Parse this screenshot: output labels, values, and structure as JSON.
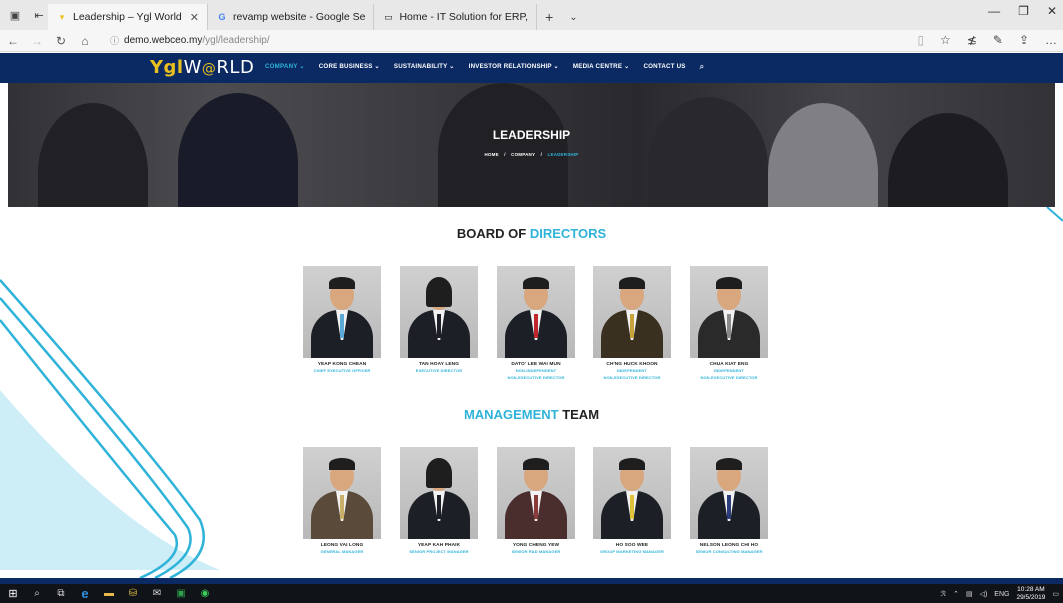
{
  "browser": {
    "tabs": [
      {
        "label": "Leadership – Ygl World",
        "icon": "ygl-favicon-icon",
        "active": true
      },
      {
        "label": "revamp website - Google Se",
        "icon": "google-icon",
        "active": false
      },
      {
        "label": "Home - IT Solution for ERP,",
        "icon": "page-icon",
        "active": false
      }
    ],
    "new_tab": "+",
    "url_host": "demo.webceo.my",
    "url_path": "/ygl/leadership/"
  },
  "site": {
    "logo_main": "Ygl",
    "logo_second": "W",
    "logo_o": "@",
    "logo_rest": "RLD",
    "menu": [
      {
        "label": "COMPANY ⌄",
        "active": true
      },
      {
        "label": "CORE BUSINESS ⌄",
        "active": false
      },
      {
        "label": "SUSTAINABILITY ⌄",
        "active": false
      },
      {
        "label": "INVESTOR RELATIONSHIP ⌄",
        "active": false
      },
      {
        "label": "MEDIA CENTRE ⌄",
        "active": false
      },
      {
        "label": "CONTACT US",
        "active": false
      }
    ],
    "search_glyph": "⌕"
  },
  "hero": {
    "title": "LEADERSHIP",
    "crumb_home": "HOME",
    "crumb_sep": "/",
    "crumb_company": "COMPANY",
    "crumb_current": "LEADERSHIP"
  },
  "board": {
    "title_a": "BOARD OF ",
    "title_b": "DIRECTORS",
    "people": [
      {
        "name": "YEAP KONG CHEAN",
        "role": "CHIEF EXECUTIVE OFFICER",
        "role2": "",
        "tie": "#5aa9d6"
      },
      {
        "name": "TAN HOAY LENG",
        "role": "EXECUTIVE DIRECTOR",
        "role2": "",
        "tie": "#1c1f26"
      },
      {
        "name": "DATO' LEE WAI MUN",
        "role": "NON-INDEPENDENT",
        "role2": "NON-EXECUTIVE DIRECTOR",
        "tie": "#c0272d"
      },
      {
        "name": "CH'NG HUCK KHOON",
        "role": "INDEPENDENT",
        "role2": "NON-EXECUTIVE DIRECTOR",
        "tie": "#c9a23c"
      },
      {
        "name": "CHUA KIAT ENG",
        "role": "INDEPENDENT",
        "role2": "NON-EXECUTIVE DIRECTOR",
        "tie": "#8a8a8a"
      }
    ]
  },
  "management": {
    "title_a": "MANAGEMENT",
    "title_b": " TEAM",
    "people": [
      {
        "name": "LEONG VAI LONG",
        "role": "GENERAL MANAGER",
        "tie": "#c8b06a"
      },
      {
        "name": "YEAP KAH PHAIK",
        "role": "SENIOR PROJECT MANAGER",
        "tie": "#1c1f26"
      },
      {
        "name": "YONG CHENG YEW",
        "role": "SENIOR R&D MANAGER",
        "tie": "#8b3a3a"
      },
      {
        "name": "HO SOO WEE",
        "role": "GROUP MARKETING MANAGER",
        "tie": "#e0c23a"
      },
      {
        "name": "NELSON LEONG CHI HO",
        "role": "SENIOR CONSULTING MANAGER",
        "tie": "#2b3d7a"
      }
    ]
  },
  "taskbar": {
    "lang": "ENG",
    "time": "10:28 AM",
    "date": "29/5/2019"
  }
}
